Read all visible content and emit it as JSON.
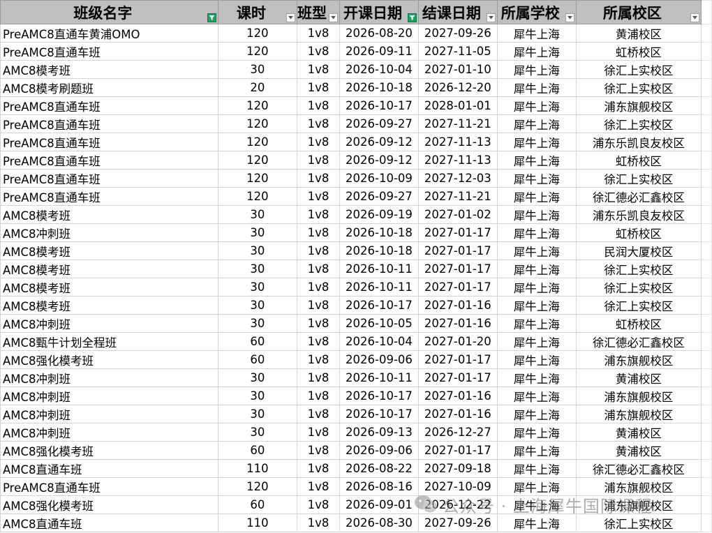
{
  "headers": [
    {
      "label": "班级名字",
      "filter": "active"
    },
    {
      "label": "课时",
      "filter": "dropdown"
    },
    {
      "label": "班型",
      "filter": "dropdown"
    },
    {
      "label": "开课日期",
      "filter": "active"
    },
    {
      "label": "结课日期",
      "filter": "dropdown"
    },
    {
      "label": "所属学校",
      "filter": "dropdown"
    },
    {
      "label": "所属校区",
      "filter": "dropdown"
    }
  ],
  "rows": [
    [
      "PreAMC8直通车黄浦OMO",
      "120",
      "1v8",
      "2026-08-20",
      "2027-09-26",
      "犀牛上海",
      "黄浦校区"
    ],
    [
      "PreAMC8直通车班",
      "120",
      "1v8",
      "2026-09-11",
      "2027-11-05",
      "犀牛上海",
      "虹桥校区"
    ],
    [
      "AMC8模考班",
      "30",
      "1v8",
      "2026-10-04",
      "2027-01-10",
      "犀牛上海",
      "徐汇上实校区"
    ],
    [
      "AMC8模考刷题班",
      "20",
      "1v8",
      "2026-10-18",
      "2026-12-20",
      "犀牛上海",
      "徐汇上实校区"
    ],
    [
      "PreAMC8直通车班",
      "120",
      "1v8",
      "2026-10-17",
      "2028-01-01",
      "犀牛上海",
      "浦东旗舰校区"
    ],
    [
      "PreAMC8直通车班",
      "120",
      "1v8",
      "2026-09-27",
      "2027-11-21",
      "犀牛上海",
      "徐汇上实校区"
    ],
    [
      "PreAMC8直通车班",
      "120",
      "1v8",
      "2026-09-12",
      "2027-11-13",
      "犀牛上海",
      "浦东乐凯良友校区"
    ],
    [
      "PreAMC8直通车班",
      "120",
      "1v8",
      "2026-09-12",
      "2027-11-13",
      "犀牛上海",
      "虹桥校区"
    ],
    [
      "PreAMC8直通车班",
      "120",
      "1v8",
      "2026-10-09",
      "2027-12-03",
      "犀牛上海",
      "徐汇上实校区"
    ],
    [
      "PreAMC8直通车班",
      "120",
      "1v8",
      "2026-09-27",
      "2027-11-21",
      "犀牛上海",
      "徐汇德必汇鑫校区"
    ],
    [
      "AMC8模考班",
      "30",
      "1v8",
      "2026-09-19",
      "2027-01-02",
      "犀牛上海",
      "浦东乐凯良友校区"
    ],
    [
      "AMC8冲刺班",
      "30",
      "1v8",
      "2026-10-18",
      "2027-01-17",
      "犀牛上海",
      "虹桥校区"
    ],
    [
      "AMC8模考班",
      "30",
      "1v8",
      "2026-10-18",
      "2027-01-17",
      "犀牛上海",
      "民润大厦校区"
    ],
    [
      "AMC8模考班",
      "30",
      "1v8",
      "2026-10-11",
      "2027-01-17",
      "犀牛上海",
      "徐汇上实校区"
    ],
    [
      "AMC8模考班",
      "30",
      "1v8",
      "2026-10-11",
      "2027-01-17",
      "犀牛上海",
      "徐汇上实校区"
    ],
    [
      "AMC8模考班",
      "30",
      "1v8",
      "2026-10-17",
      "2027-01-16",
      "犀牛上海",
      "徐汇上实校区"
    ],
    [
      "AMC8冲刺班",
      "30",
      "1v8",
      "2026-10-05",
      "2027-01-16",
      "犀牛上海",
      "虹桥校区"
    ],
    [
      "AMC8甄牛计划全程班",
      "60",
      "1v8",
      "2026-10-04",
      "2027-01-20",
      "犀牛上海",
      "徐汇德必汇鑫校区"
    ],
    [
      "AMC8强化模考班",
      "60",
      "1v8",
      "2026-09-06",
      "2027-01-17",
      "犀牛上海",
      "浦东旗舰校区"
    ],
    [
      "AMC8冲刺班",
      "30",
      "1v8",
      "2026-10-11",
      "2027-01-17",
      "犀牛上海",
      "黄浦校区"
    ],
    [
      "AMC8冲刺班",
      "30",
      "1v8",
      "2026-10-17",
      "2027-01-16",
      "犀牛上海",
      "浦东旗舰校区"
    ],
    [
      "AMC8冲刺班",
      "30",
      "1v8",
      "2026-10-17",
      "2027-01-16",
      "犀牛上海",
      "浦东旗舰校区"
    ],
    [
      "AMC8冲刺班",
      "30",
      "1v8",
      "2026-09-13",
      "2026-12-27",
      "犀牛上海",
      "黄浦校区"
    ],
    [
      "AMC8强化模考班",
      "60",
      "1v8",
      "2026-09-06",
      "2027-01-17",
      "犀牛上海",
      "黄浦校区"
    ],
    [
      "AMC8直通车班",
      "110",
      "1v8",
      "2026-08-22",
      "2027-09-18",
      "犀牛上海",
      "徐汇德必汇鑫校区"
    ],
    [
      "PreAMC8直通车班",
      "120",
      "1v8",
      "2026-08-16",
      "2027-10-09",
      "犀牛上海",
      "浦东旗舰校区"
    ],
    [
      "AMC8强化模考班",
      "60",
      "1v8",
      "2026-09-01",
      "2026-12-22",
      "犀牛上海",
      "浦东旗舰校区"
    ],
    [
      "AMC8直通车班",
      "110",
      "1v8",
      "2026-08-30",
      "2027-09-26",
      "犀牛上海",
      "徐汇上实校区"
    ]
  ],
  "watermark": {
    "text": "公众号 · 上海犀牛国际课程",
    "icon": "wechat-icon"
  },
  "colors": {
    "header_bg": "#bfbfbf",
    "filter_active": "#1f9e6a",
    "grid": "#d4d4d4"
  }
}
